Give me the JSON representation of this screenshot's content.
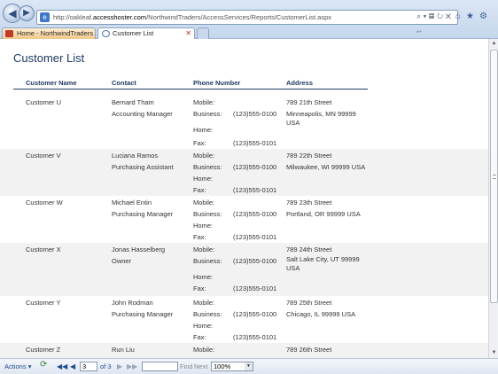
{
  "browser": {
    "url_prefix": "http://oakleaf.",
    "url_domain": "accesshoster.com",
    "url_path": "/NorthwindTraders/AccessServices/Reports/CustomerList.aspx",
    "tabs": [
      {
        "label": "Home - NorthwindTraders"
      },
      {
        "label": "Customer List"
      }
    ]
  },
  "report": {
    "title": "Customer List",
    "columns": [
      "Customer Name",
      "Contact",
      "Phone Number",
      "Address"
    ],
    "phone_labels": [
      "Mobile:",
      "Business:",
      "Home:",
      "Fax:"
    ],
    "rows": [
      {
        "name": "Customer U",
        "contact": "Bernard Tham",
        "title": "Accounting Manager",
        "business": "(123)555-0100",
        "fax": "(123)555-0101",
        "street": "789 21th Street",
        "city": "Minneapolis, MN 99999 USA"
      },
      {
        "name": "Customer V",
        "contact": "Luciana Ramos",
        "title": "Purchasing Assistant",
        "business": "(123)555-0100",
        "fax": "(123)555-0101",
        "street": "789 22th Street",
        "city": "Milwaukee, WI 99999 USA"
      },
      {
        "name": "Customer W",
        "contact": "Michael Entin",
        "title": "Purchasing Manager",
        "business": "(123)555-0100",
        "fax": "(123)555-0101",
        "street": "789 23th Street",
        "city": "Portland, OR 99999 USA"
      },
      {
        "name": "Customer X",
        "contact": "Jonas Hasselberg",
        "title": "Owner",
        "business": "(123)555-0100",
        "fax": "(123)555-0101",
        "street": "789 24th Street",
        "city": "Salt Lake City, UT 99999 USA"
      },
      {
        "name": "Customer Y",
        "contact": "John Rodman",
        "title": "Purchasing Manager",
        "business": "(123)555-0100",
        "fax": "(123)555-0101",
        "street": "789 25th Street",
        "city": "Chicago, IL 99999 USA"
      },
      {
        "name": "Customer Z",
        "contact": "Run Liu",
        "title": "",
        "business": "",
        "fax": "",
        "street": "789 26th Street",
        "city": ""
      }
    ]
  },
  "toolbar": {
    "actions_label": "Actions",
    "page_value": "3",
    "page_of": "of 3",
    "find_label": "Find",
    "find_next_label": "Next",
    "zoom_value": "100%"
  }
}
